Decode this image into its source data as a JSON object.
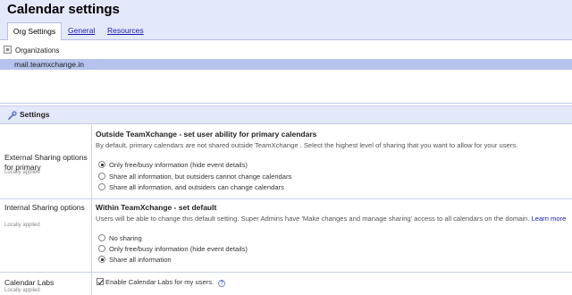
{
  "header": {
    "title": "Calendar settings"
  },
  "tabs": [
    {
      "label": "Org Settings",
      "active": true
    },
    {
      "label": "General",
      "active": false
    },
    {
      "label": "Resources",
      "active": false
    }
  ],
  "organizations": {
    "heading": "Organizations",
    "selected": "mail.teamxchange.in"
  },
  "settings": {
    "heading": "Settings",
    "external": {
      "label": "External Sharing options for primary",
      "locally": "Locally applied",
      "title": "Outside TeamXchange - set user ability for primary calendars",
      "desc": "By default, primary calendars are not shared outside TeamXchange . Select the highest level of sharing that you want to allow for your users.",
      "options": [
        {
          "label": "Only free/busy information (hide event details)",
          "checked": true
        },
        {
          "label": "Share all information, but outsiders cannot change calendars",
          "checked": false
        },
        {
          "label": "Share all information, and outsiders can change calendars",
          "checked": false
        }
      ]
    },
    "internal": {
      "label": "Internal Sharing options",
      "locally": "Locally applied",
      "title": "Within TeamXchange - set default",
      "desc": "Users will be able to change this default setting. Super Admins have 'Make changes and manage sharing' access to all calendars on the domain.",
      "learn_more": "Learn more",
      "options": [
        {
          "label": "No sharing",
          "checked": false
        },
        {
          "label": "Only free/busy information (hide event details)",
          "checked": false
        },
        {
          "label": "Share all information",
          "checked": true
        }
      ]
    },
    "labs": {
      "label": "Calendar Labs",
      "locally": "Locally applied",
      "checkbox_label": "Enable Calendar Labs for my users.",
      "checked": true,
      "help_glyph": "?"
    }
  },
  "colors": {
    "header_bg": "#e4e8fb",
    "selection_bg": "#b6c3ee",
    "link": "#1a1ab0"
  }
}
